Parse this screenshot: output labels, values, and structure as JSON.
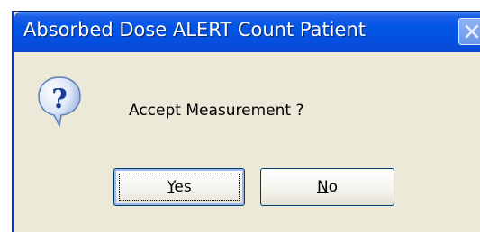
{
  "dialog": {
    "title": "Absorbed Dose ALERT  Count Patient",
    "message": "Accept Measurement ?",
    "icon": "question-icon",
    "buttons": {
      "yes": {
        "label_accel": "Y",
        "label_rest": "es"
      },
      "no": {
        "label_accel": "N",
        "label_rest": "o"
      }
    }
  },
  "colors": {
    "titlebar": "#0055e5",
    "window_bg": "#ece9d8",
    "close_button": "#6b97e9"
  }
}
